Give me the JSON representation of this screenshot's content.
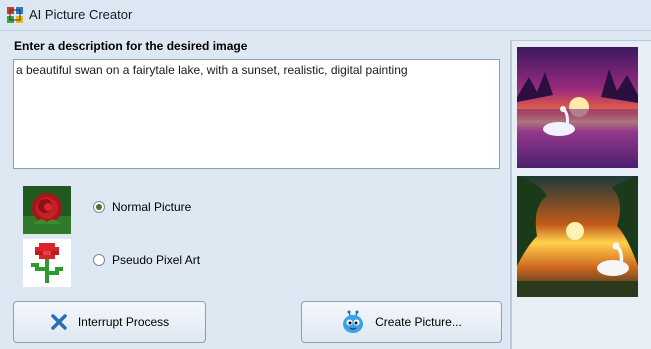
{
  "window": {
    "title": "AI Picture Creator"
  },
  "prompt": {
    "label": "Enter a description for the desired image",
    "value": "a beautiful swan on a fairytale lake, with a sunset, realistic, digital painting"
  },
  "options": [
    {
      "label": "Normal Picture",
      "checked": true
    },
    {
      "label": "Pseudo Pixel Art",
      "checked": false
    }
  ],
  "buttons": {
    "interrupt_label": "Interrupt Process",
    "create_label": "Create Picture..."
  },
  "colors": {
    "accent": "#2a6fb6",
    "background": "#dde8f3"
  }
}
